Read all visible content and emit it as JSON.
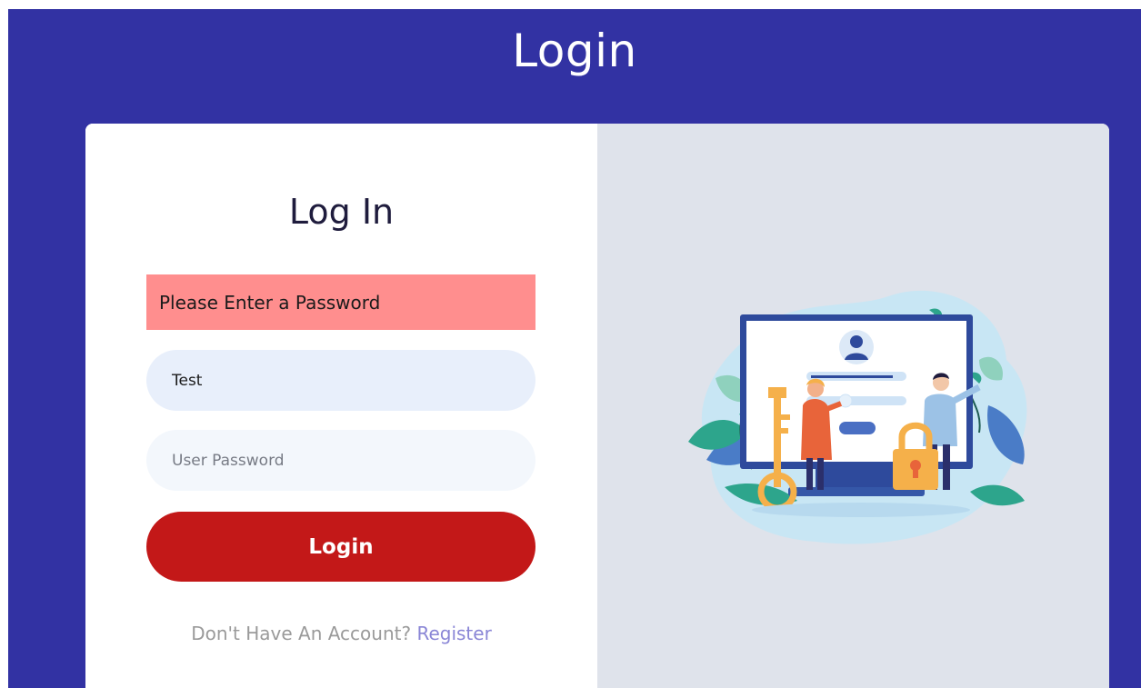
{
  "page": {
    "title": "Login"
  },
  "form": {
    "heading": "Log In",
    "error_message": "Please Enter a Password",
    "username_value": "Test",
    "password_placeholder": "User Password",
    "login_button_label": "Login",
    "register_prompt": "Don't Have An Account?",
    "register_link_label": "Register"
  },
  "colors": {
    "page_background": "#3232a3",
    "error_banner": "#ff8e8e",
    "login_button": "#c31818",
    "register_link": "#8a86d6",
    "illustration_panel": "#dfe3eb"
  },
  "icons": {
    "illustration": "login-security-illustration"
  }
}
